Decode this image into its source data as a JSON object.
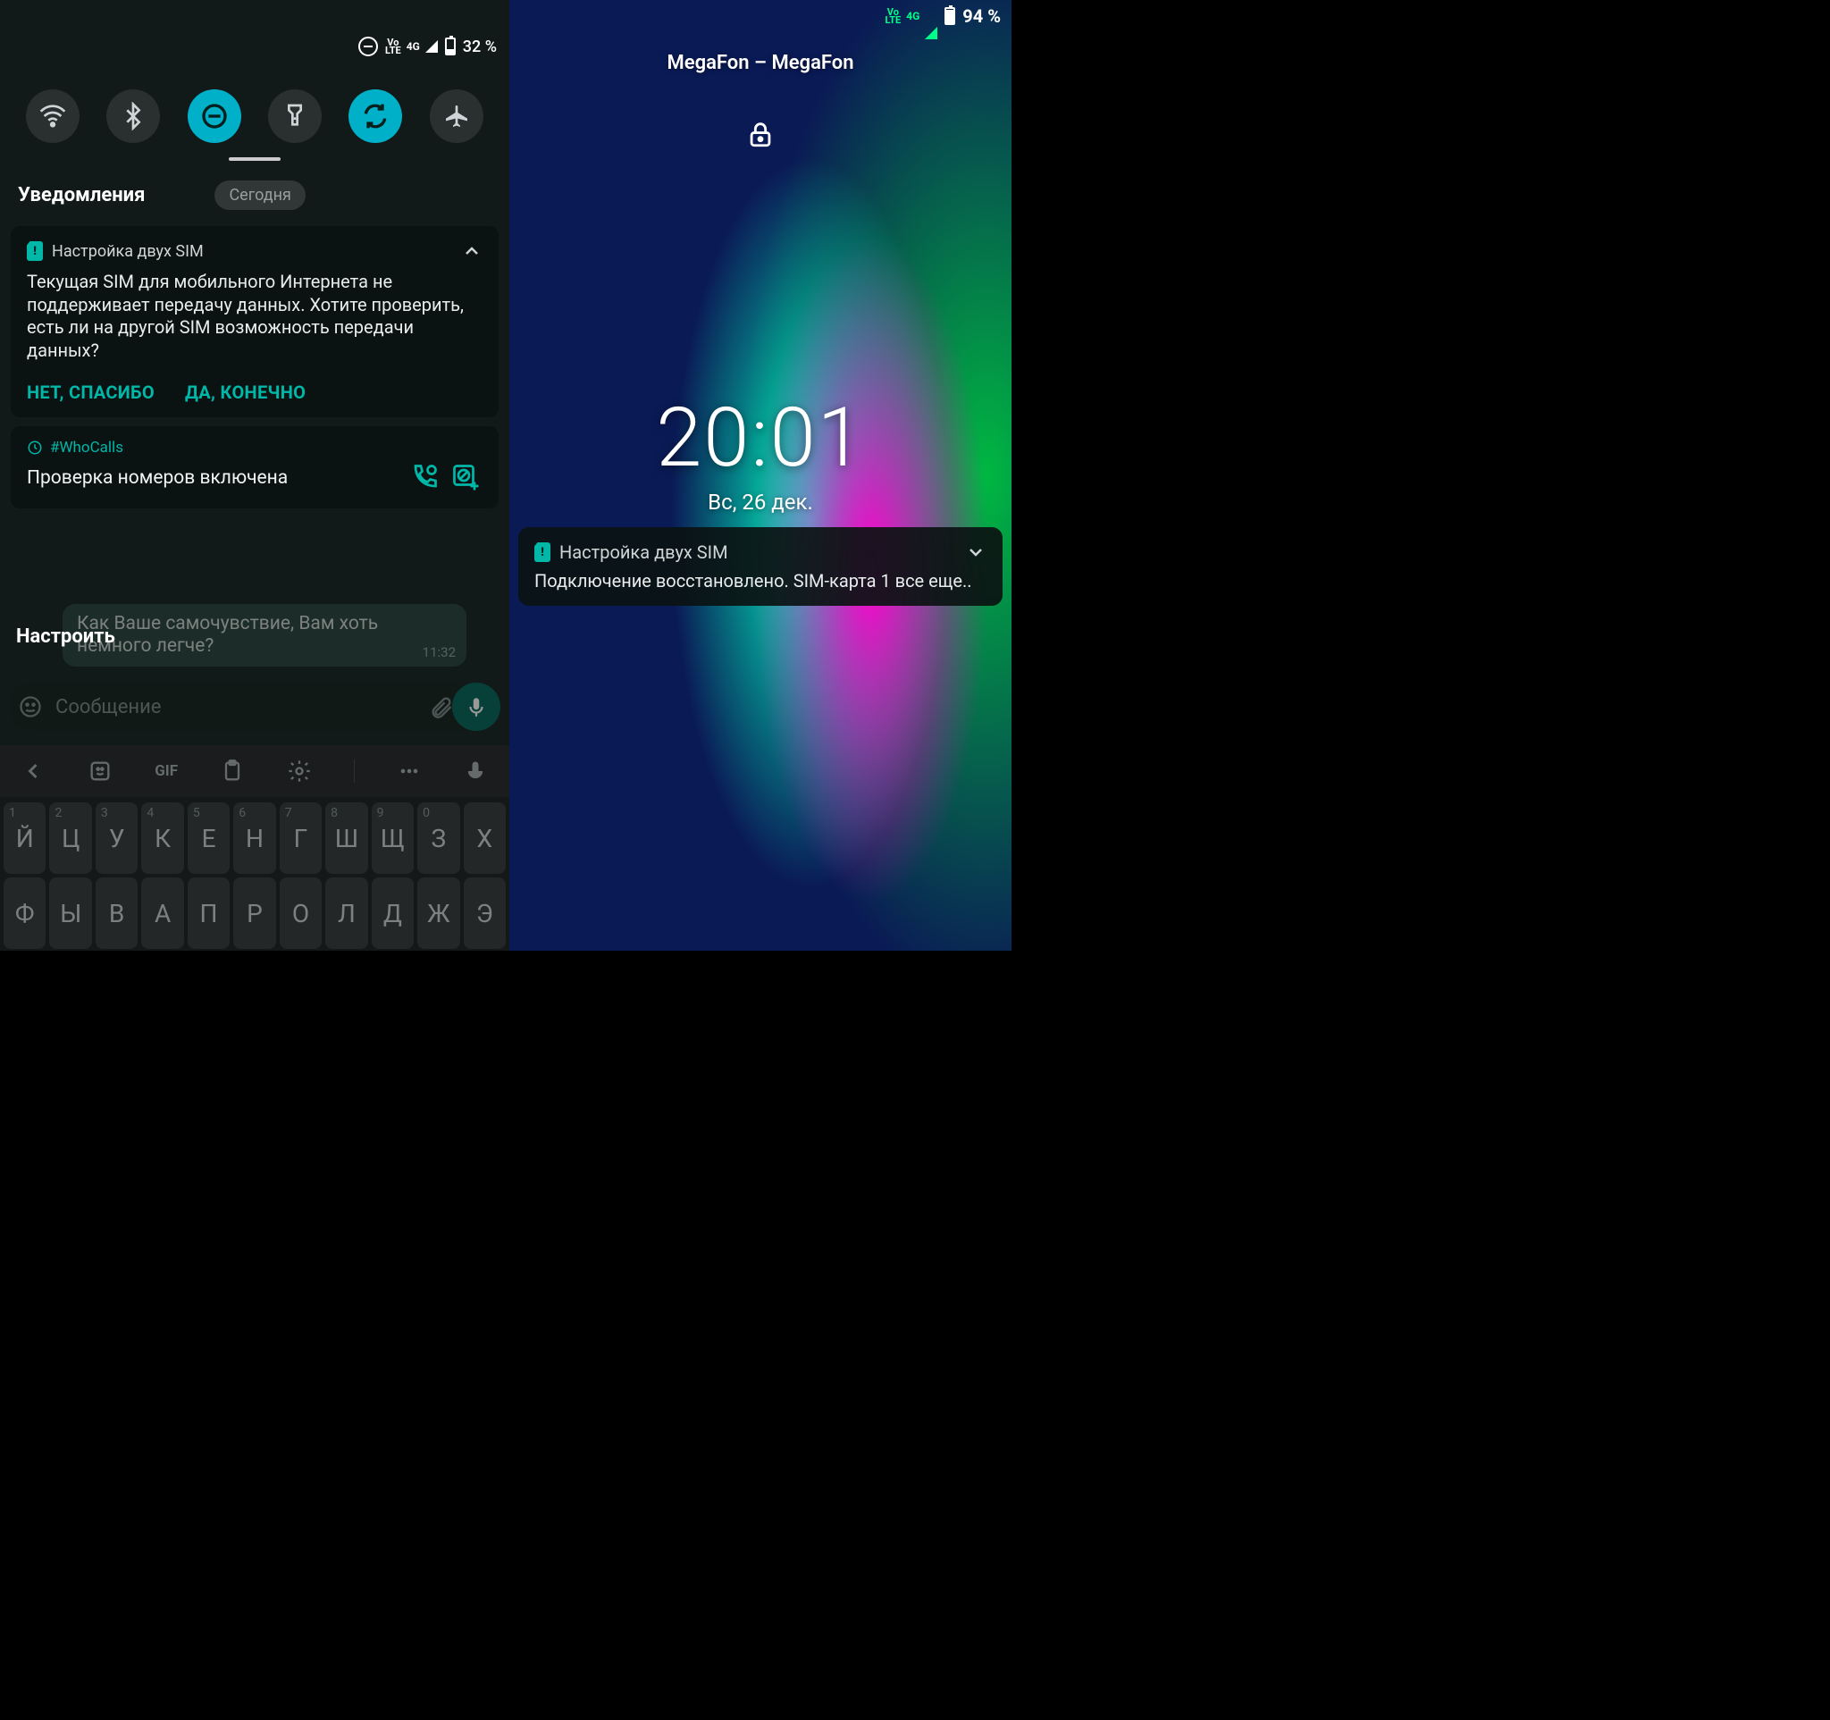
{
  "left": {
    "status": {
      "volte": "Vo\nLTE",
      "net": "4G",
      "battery_text": "32 %",
      "battery_fill_pct": 32
    },
    "qs": [
      {
        "name": "wifi",
        "active": false
      },
      {
        "name": "bluetooth",
        "active": false
      },
      {
        "name": "dnd",
        "active": true
      },
      {
        "name": "flashlight",
        "active": false
      },
      {
        "name": "autorotate",
        "active": true
      },
      {
        "name": "airplane",
        "active": false
      }
    ],
    "notifications_header": "Уведомления",
    "today_pill": "Сегодня",
    "sim_card": {
      "title": "Настройка двух SIM",
      "body": "Текущая SIM для мобильного Интернета не поддерживает передачу данных. Хотите проверить, есть ли на другой SIM возможность передачи данных?",
      "action_no": "НЕТ, СПАСИБО",
      "action_yes": "ДА, КОНЕЧНО"
    },
    "whocalls": {
      "tag": "#WhoCalls",
      "body": "Проверка номеров включена"
    },
    "configure": "Настроить",
    "chat": {
      "bubble_text": "Как Ваше самочувствие, Вам хоть немного легче?",
      "bubble_time": "11:32",
      "input_placeholder": "Сообщение",
      "gif_label": "GIF"
    },
    "keyboard": {
      "row1": [
        {
          "hint": "1",
          "ch": "Й"
        },
        {
          "hint": "2",
          "ch": "Ц"
        },
        {
          "hint": "3",
          "ch": "У"
        },
        {
          "hint": "4",
          "ch": "К"
        },
        {
          "hint": "5",
          "ch": "Е"
        },
        {
          "hint": "6",
          "ch": "Н"
        },
        {
          "hint": "7",
          "ch": "Г"
        },
        {
          "hint": "8",
          "ch": "Ш"
        },
        {
          "hint": "9",
          "ch": "Щ"
        },
        {
          "hint": "0",
          "ch": "З"
        },
        {
          "hint": "",
          "ch": "Х"
        }
      ],
      "row2": [
        {
          "ch": "Ф"
        },
        {
          "ch": "Ы"
        },
        {
          "ch": "В"
        },
        {
          "ch": "А"
        },
        {
          "ch": "П"
        },
        {
          "ch": "Р"
        },
        {
          "ch": "О"
        },
        {
          "ch": "Л"
        },
        {
          "ch": "Д"
        },
        {
          "ch": "Ж"
        },
        {
          "ch": "Э"
        }
      ]
    }
  },
  "right": {
    "status": {
      "volte": "Vo\nLTE",
      "net": "4G",
      "battery_text": "94 %",
      "battery_fill_pct": 94
    },
    "carrier": "MegaFon – MegaFon",
    "clock": "20:01",
    "date": "Вс, 26 дек.",
    "card": {
      "title": "Настройка двух SIM",
      "body": "Подключение восстановлено. SIM-карта 1 все еще.."
    }
  }
}
